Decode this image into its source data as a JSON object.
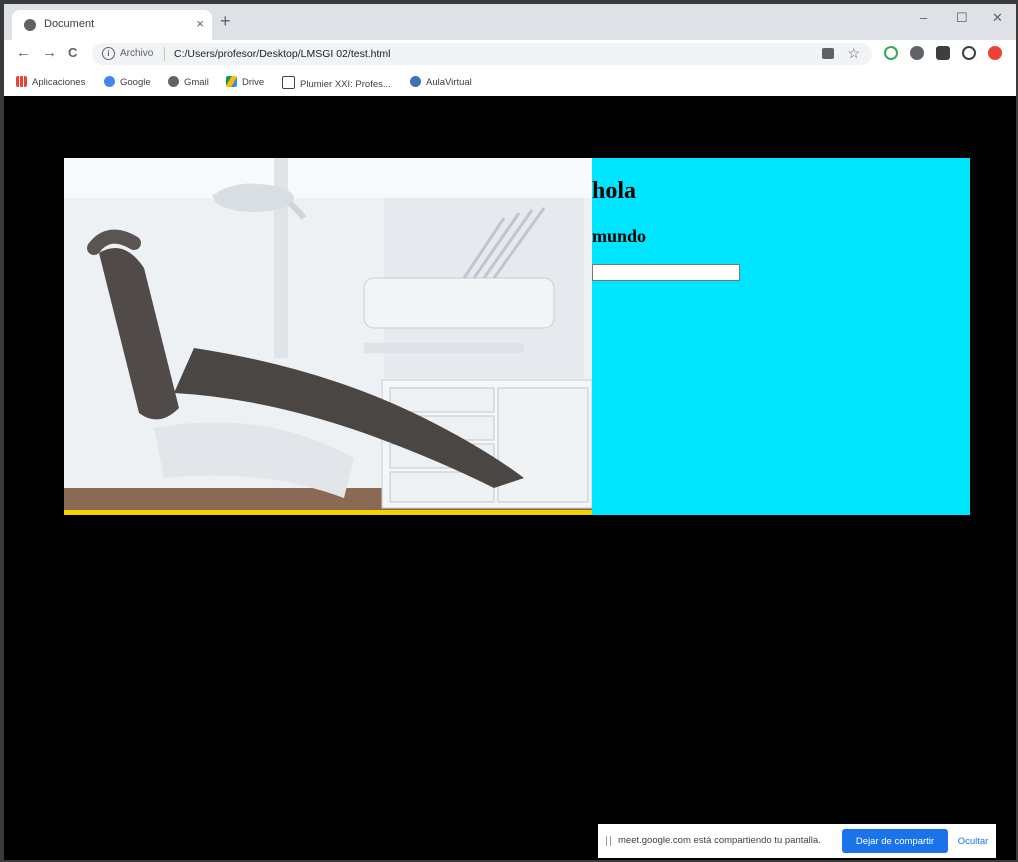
{
  "browser": {
    "tab": {
      "title": "Document",
      "close": "×"
    },
    "new_tab": "+",
    "window_controls": {
      "minimize": "–",
      "maximize": "☐",
      "close": "✕"
    },
    "nav": {
      "back": "←",
      "forward": "→",
      "reload": "C"
    },
    "omnibox": {
      "info": "i",
      "scheme": "Archivo",
      "url": "C:/Users/profesor/Desktop/LMSGI 02/test.html"
    },
    "bookmarks": [
      {
        "label": "Aplicaciones",
        "icon": "apps-grid-icon",
        "color": "#ea4335"
      },
      {
        "label": "Google",
        "icon": "google-icon",
        "color": "#4285f4"
      },
      {
        "label": "Gmail",
        "icon": "gmail-icon",
        "color": "#5f6368"
      },
      {
        "label": "Drive",
        "icon": "drive-icon",
        "color": "#0f9d58"
      },
      {
        "label": "Plumier XXI: Profes...",
        "icon": "plumier-icon",
        "color": "#444444"
      },
      {
        "label": "AulaVirtual",
        "icon": "aulavirtual-icon",
        "color": "#3f6fb5"
      }
    ]
  },
  "page": {
    "heading": "hola",
    "subheading": "mundo",
    "input_value": "",
    "image_alt": "dental chair",
    "colors": {
      "background": "#000000",
      "panel": "#00e5ff",
      "image_border": "#f5d000"
    }
  },
  "share_bar": {
    "message": "meet.google.com está compartiendo tu pantalla.",
    "stop_label": "Dejar de compartir",
    "hide_label": "Ocultar"
  }
}
